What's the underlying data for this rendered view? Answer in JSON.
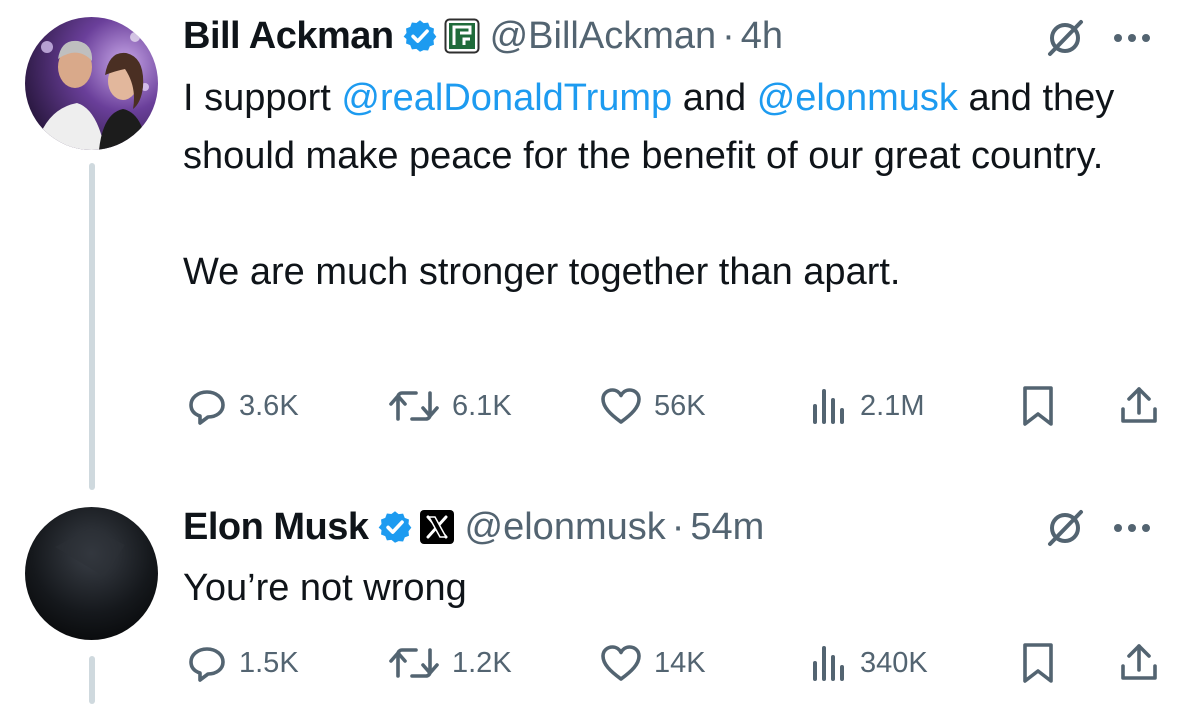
{
  "tweets": [
    {
      "author": {
        "name": "Bill Ackman",
        "handle": "@BillAckman",
        "verified": true,
        "affiliation_icon": "pershing-square-logo"
      },
      "time": "4h",
      "text": {
        "pre": "I support ",
        "mention1": "@realDonaldTrump",
        "mid": " and ",
        "mention2": "@elonmusk",
        "post": " and they should make peace for the benefit of our great country.",
        "para2": "We are much stronger together than apart."
      },
      "stats": {
        "replies": "3.6K",
        "reposts": "6.1K",
        "likes": "56K",
        "views": "2.1M"
      }
    },
    {
      "author": {
        "name": "Elon Musk",
        "handle": "@elonmusk",
        "verified": true,
        "affiliation_icon": "x-logo"
      },
      "time": "54m",
      "text": {
        "body": "You’re not wrong"
      },
      "stats": {
        "replies": "1.5K",
        "reposts": "1.2K",
        "likes": "14K",
        "views": "340K"
      }
    }
  ],
  "ui": {
    "separator": "·"
  },
  "colors": {
    "accent": "#1d9bf0",
    "muted": "#536471",
    "text": "#0f1419",
    "thread_line": "#cfd9de"
  }
}
